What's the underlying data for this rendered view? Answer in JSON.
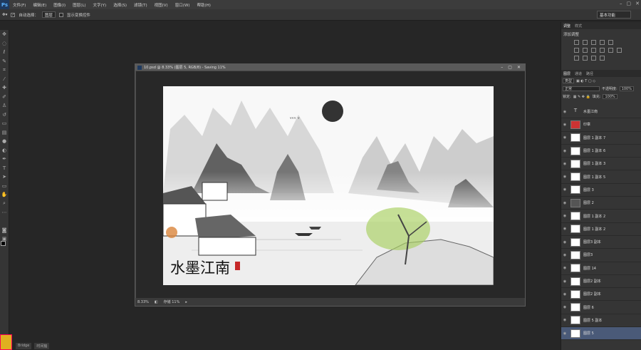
{
  "app": {
    "logo": "Ps"
  },
  "menu": [
    "文件(F)",
    "编辑(E)",
    "图像(I)",
    "图层(L)",
    "文字(Y)",
    "选择(S)",
    "滤镜(T)",
    "视图(V)",
    "窗口(W)",
    "帮助(H)"
  ],
  "options": {
    "auto_select_label": "自动选择：",
    "auto_select_value": "图层",
    "transform_label": "显示变换控件",
    "workspace": "基本功能"
  },
  "document": {
    "title": "10.psd @ 8.33% (图层 5, RGB/8) - Saving 11%",
    "zoom": "8.33%",
    "status": "存储 11%"
  },
  "canvas_art": {
    "calligraphy": "水墨江南"
  },
  "panels": {
    "tab_adjust": "调整",
    "tab_style": "样式",
    "adjust_title": "添加调整",
    "tab_layers": "图层",
    "tab_channels": "通道",
    "tab_paths": "路径",
    "kind_label": "类型",
    "blend_mode": "正常",
    "opacity_label": "不透明度:",
    "opacity": "100%",
    "lock_label": "锁定:",
    "fill_label": "填充:",
    "fill": "100%"
  },
  "layers": [
    {
      "name": "水墨江南",
      "type": "text"
    },
    {
      "name": "印章",
      "type": "red"
    },
    {
      "name": "图层 1 副本 7",
      "type": "img"
    },
    {
      "name": "图层 1 副本 6",
      "type": "img"
    },
    {
      "name": "图层 1 副本 3",
      "type": "img"
    },
    {
      "name": "图层 1 副本 5",
      "type": "img"
    },
    {
      "name": "图层 3",
      "type": "img"
    },
    {
      "name": "图层 2",
      "type": "dark"
    },
    {
      "name": "图层 1 副本 2",
      "type": "img"
    },
    {
      "name": "图层 1 副本 2",
      "type": "img"
    },
    {
      "name": "图层3 副本",
      "type": "img"
    },
    {
      "name": "图层3",
      "type": "img"
    },
    {
      "name": "图层 14",
      "type": "img"
    },
    {
      "name": "图层2 副本",
      "type": "img"
    },
    {
      "name": "图层2 副本",
      "type": "img"
    },
    {
      "name": "图层 6",
      "type": "img"
    },
    {
      "name": "图层 5 副本",
      "type": "img"
    },
    {
      "name": "图层 5",
      "type": "img",
      "selected": true
    }
  ],
  "bottom_tabs": [
    "Bridge",
    "时间轴"
  ]
}
